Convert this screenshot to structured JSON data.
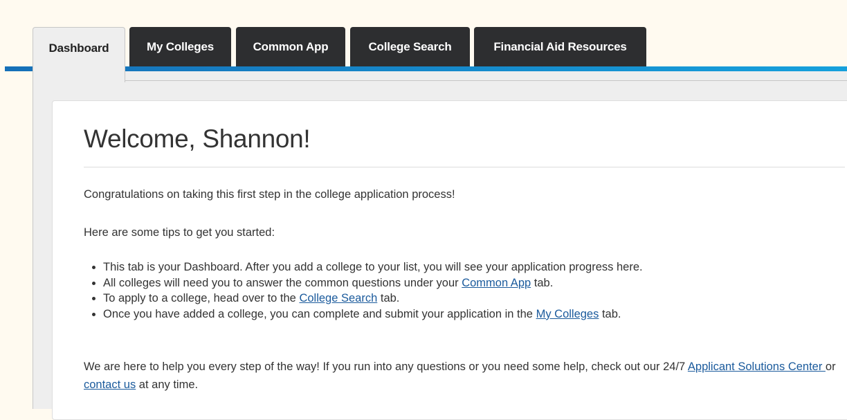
{
  "tabs": {
    "dashboard": "Dashboard",
    "my_colleges": "My Colleges",
    "common_app": "Common App",
    "college_search": "College Search",
    "financial_aid": "Financial Aid Resources"
  },
  "main": {
    "welcome": "Welcome, Shannon!",
    "intro": "Congratulations on taking this first step in the college application process!",
    "tips_heading": "Here are some tips to get you started:",
    "tips": [
      {
        "text": "This tab is your Dashboard. After you add a college to your list, you will see your application progress here."
      },
      {
        "before": "All colleges will need you to answer the common questions under your ",
        "link": "Common App",
        "after": " tab."
      },
      {
        "before": "To apply to a college, head over to the ",
        "link": "College Search",
        "after": " tab."
      },
      {
        "before": "Once you have added a college, you can complete and submit your application in the ",
        "link": "My Colleges",
        "after": " tab."
      }
    ],
    "help": {
      "before": "We are here to help you every step of the way! If you run into any questions or you need some help, check out our 24/7 ",
      "link1": "Applicant Solutions Center ",
      "middle": "or ",
      "link2": "contact us",
      "after": " at any time."
    }
  },
  "colors": {
    "accent_blue": "#1670b8",
    "tab_dark": "#2d2e30",
    "link": "#1a5a9c",
    "page_bg": "#fffaf0"
  }
}
